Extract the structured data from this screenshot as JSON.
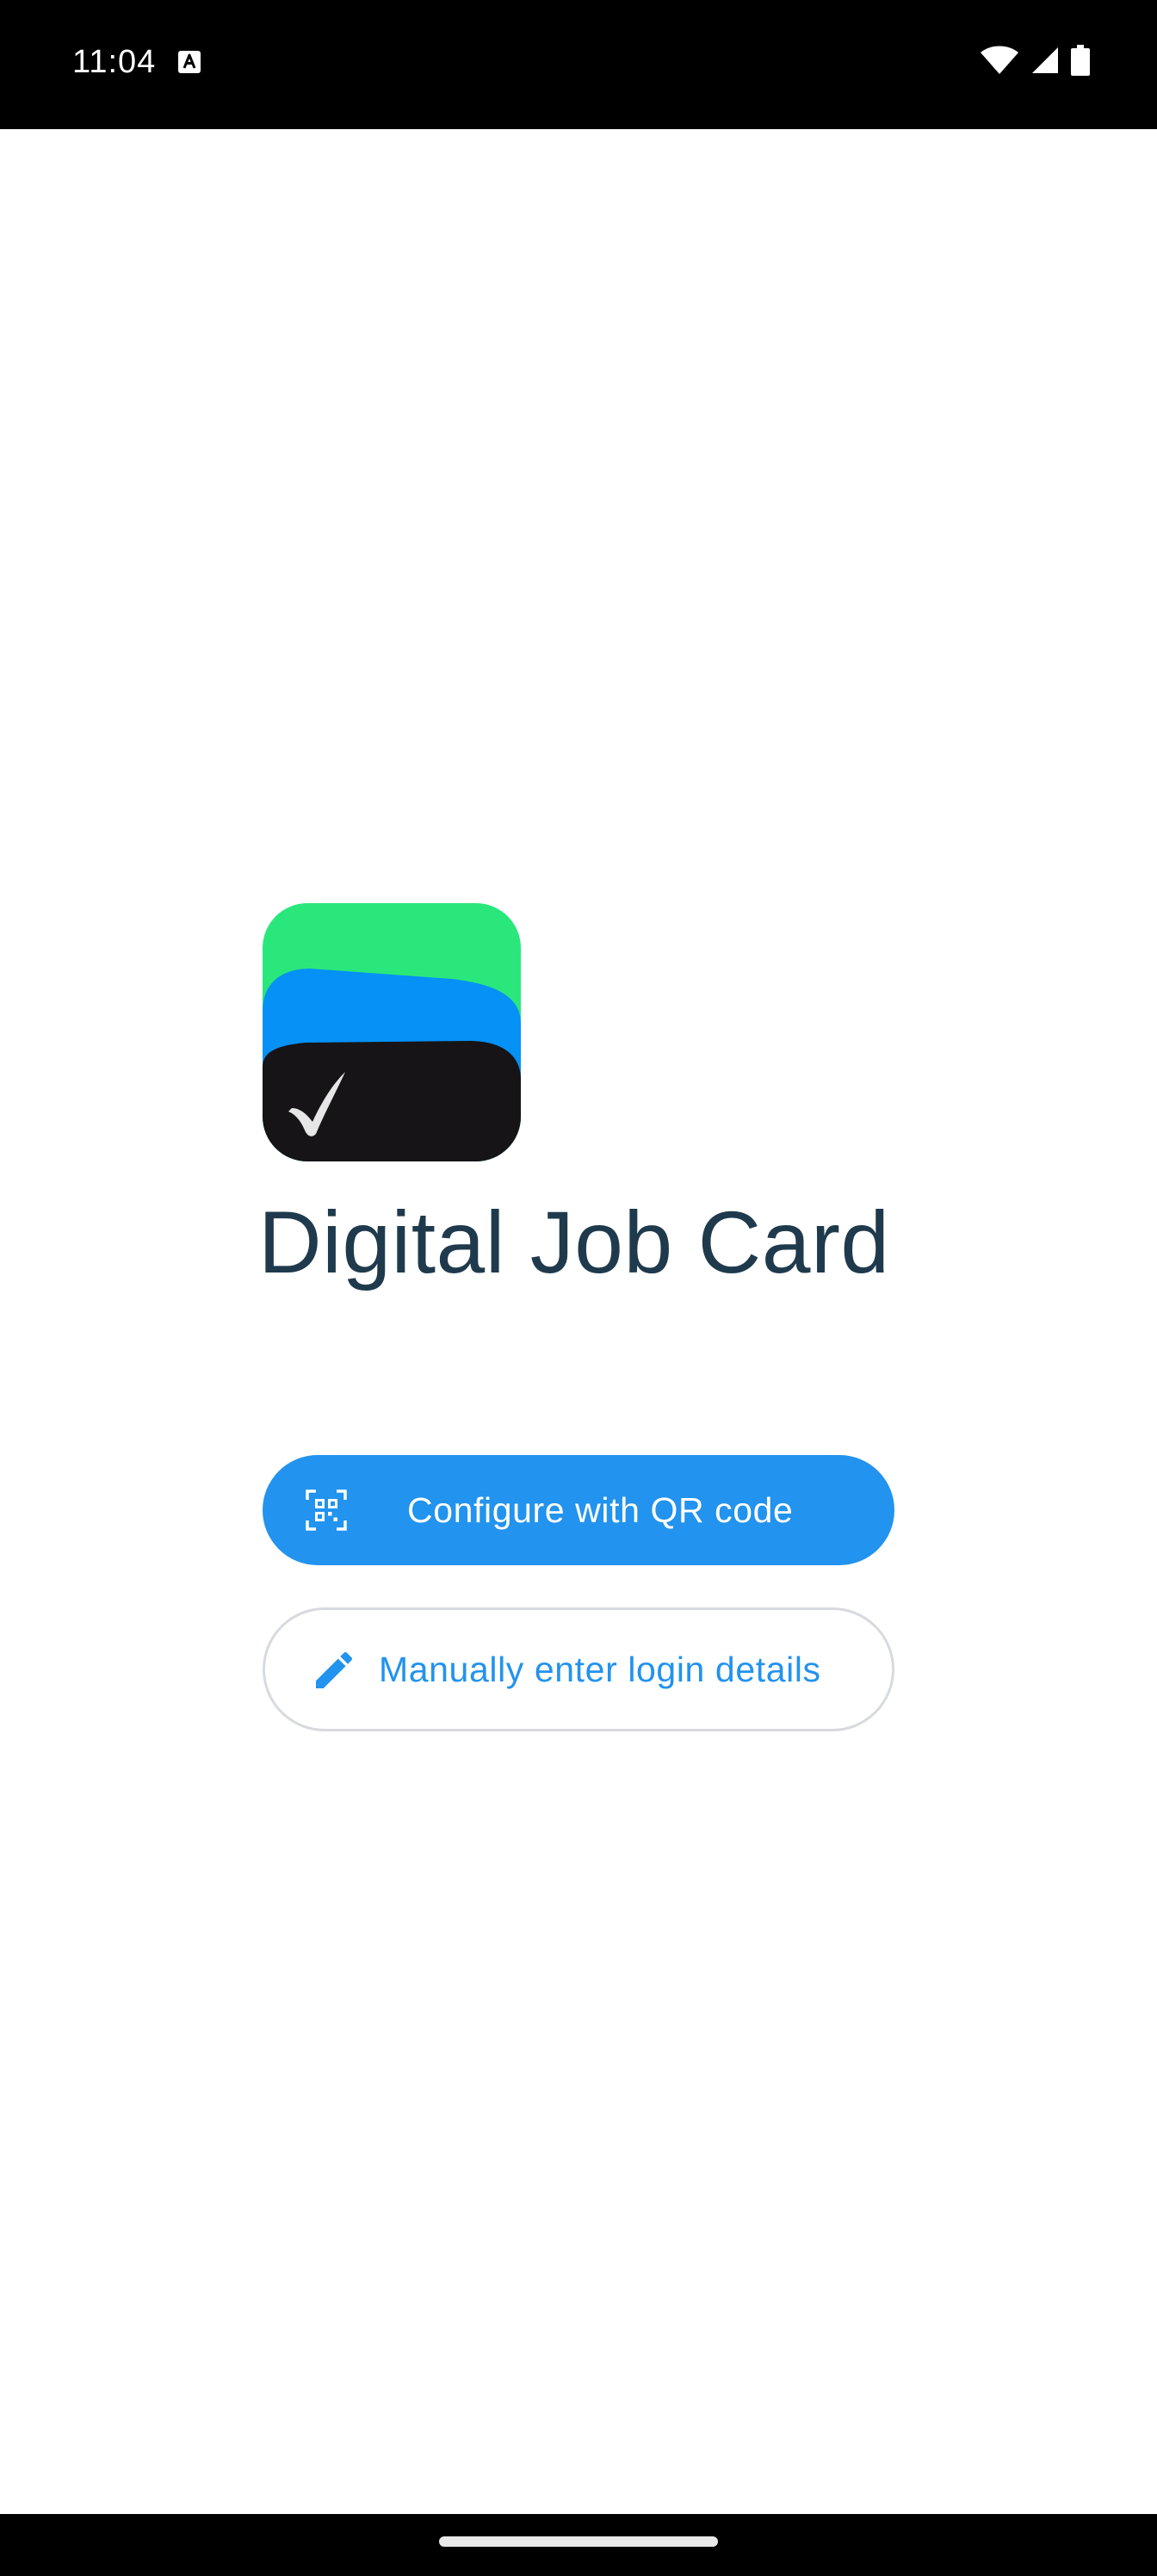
{
  "status_bar": {
    "time": "11:04",
    "notification_icon": "text-a-icon",
    "icons": [
      "wifi-icon",
      "cellular-signal-icon",
      "battery-icon"
    ]
  },
  "app": {
    "logo_icon": "digital-job-card-logo",
    "title": "Digital Job Card"
  },
  "actions": {
    "qr_button": {
      "label": "Configure with QR code",
      "icon": "qr-scan-icon"
    },
    "manual_button": {
      "label": "Manually enter login details",
      "icon": "pencil-icon"
    }
  },
  "colors": {
    "primary": "#2293ee",
    "title_text": "#1f3a4c",
    "logo_green": "#2ae77c",
    "logo_blue": "#0591f5",
    "logo_dark": "#161416",
    "outline": "#d7dade"
  },
  "nav_bar": {
    "handle": "gesture-handle"
  }
}
